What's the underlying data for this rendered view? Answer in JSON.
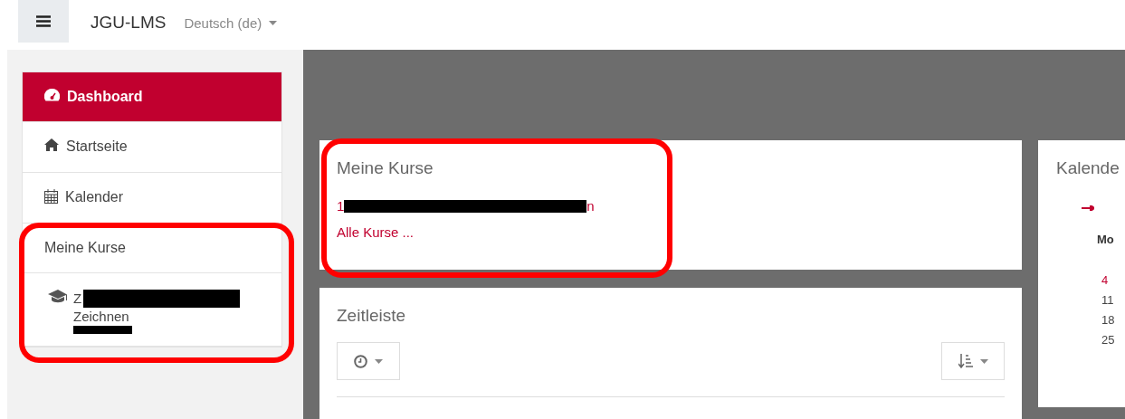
{
  "navbar": {
    "brand": "JGU-LMS",
    "language": "Deutsch (de)"
  },
  "sidebar": {
    "items": [
      {
        "kind": "link",
        "label": "Dashboard",
        "selected": true
      },
      {
        "kind": "link",
        "label": "Startseite",
        "selected": false
      },
      {
        "kind": "link",
        "label": "Kalender",
        "selected": false
      },
      {
        "kind": "heading",
        "label": "Meine Kurse"
      },
      {
        "kind": "course",
        "lines": [
          "Z",
          "Zeichnen"
        ]
      }
    ]
  },
  "my_courses": {
    "title": "Meine Kurse",
    "course_link": {
      "before": "1",
      "after": "n"
    },
    "all_link": "Alle Kurse ..."
  },
  "timeline": {
    "title": "Zeitleiste"
  },
  "calendar": {
    "title": "Kalende",
    "weekday": "Mo",
    "days": [
      {
        "label": "4",
        "today": true
      },
      {
        "label": "11",
        "today": false
      },
      {
        "label": "18",
        "today": false
      },
      {
        "label": "25",
        "today": false
      }
    ]
  }
}
